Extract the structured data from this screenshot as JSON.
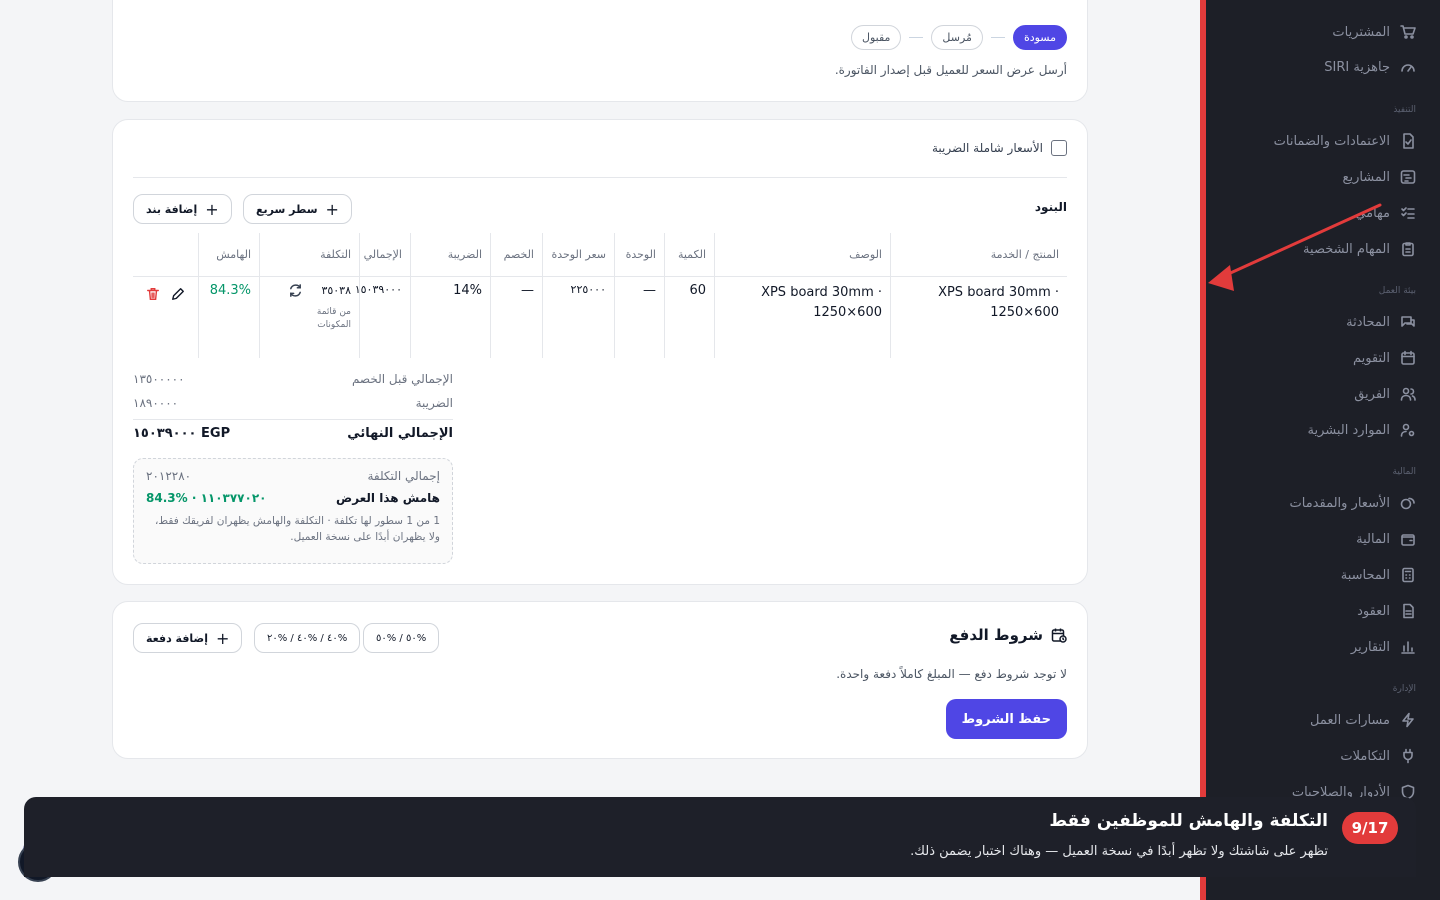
{
  "sidebar": {
    "top_items": [
      {
        "label": "المشتريات",
        "icon": "cart-icon"
      },
      {
        "label": "جاهزية SIRI",
        "icon": "gauge-icon"
      }
    ],
    "sections": [
      {
        "title": "التنفيذ",
        "items": [
          {
            "label": "الاعتمادات والضمانات",
            "icon": "file-check-icon"
          },
          {
            "label": "المشاريع",
            "icon": "gantt-icon"
          },
          {
            "label": "مهامي",
            "icon": "task-list-icon"
          },
          {
            "label": "المهام الشخصية",
            "icon": "clipboard-icon"
          }
        ]
      },
      {
        "title": "بيئة العمل",
        "items": [
          {
            "label": "المحادثة",
            "icon": "chat-icon"
          },
          {
            "label": "التقويم",
            "icon": "calendar-icon"
          },
          {
            "label": "الفريق",
            "icon": "users-icon"
          },
          {
            "label": "الموارد البشرية",
            "icon": "user-gear-icon"
          }
        ]
      },
      {
        "title": "المالية",
        "items": [
          {
            "label": "الأسعار والمقدمات",
            "icon": "coins-icon"
          },
          {
            "label": "المالية",
            "icon": "wallet-icon"
          },
          {
            "label": "المحاسبة",
            "icon": "calculator-icon"
          },
          {
            "label": "العقود",
            "icon": "document-icon"
          },
          {
            "label": "التقارير",
            "icon": "bar-chart-icon"
          }
        ]
      },
      {
        "title": "الإدارة",
        "items": [
          {
            "label": "مسارات العمل",
            "icon": "lightning-icon"
          },
          {
            "label": "التكاملات",
            "icon": "plug-icon"
          },
          {
            "label": "الأدوار والصلاحيات",
            "icon": "shield-icon"
          }
        ]
      }
    ]
  },
  "status": {
    "steps": [
      "مسودة",
      "مُرسل",
      "مقبول"
    ],
    "active": "مسودة",
    "hint": "أرسل عرض السعر للعميل قبل إصدار الفاتورة."
  },
  "items_card": {
    "tax_inclusive_label": "الأسعار شاملة الضريبة",
    "section_title": "البنود",
    "quick_row_label": "سطر سريع",
    "add_item_label": "إضافة بند",
    "columns": {
      "product": "المنتج / الخدمة",
      "description": "الوصف",
      "quantity": "الكمية",
      "unit": "الوحدة",
      "unit_price": "سعر الوحدة",
      "discount": "الخصم",
      "tax": "الضريبة",
      "total": "الإجمالي",
      "cost": "التكلفة",
      "margin": "الهامش"
    },
    "row": {
      "product": "XPS board 30mm · 1250×600",
      "description": "XPS board 30mm · 1250×600",
      "quantity": "60",
      "unit": "—",
      "unit_price": "٢٢٥٠٠٠",
      "discount": "—",
      "tax": "14%",
      "total": "١٥٠٣٩٠٠٠",
      "cost": "٣٥٠٣٨",
      "cost_source": "من قائمة المكونات",
      "margin": "84.3%"
    },
    "summary": {
      "subtotal_label": "الإجمالي قبل الخصم",
      "subtotal_value": "١٣٥٠٠٠٠٠",
      "tax_label": "الضريبة",
      "tax_value": "١٨٩٠٠٠٠",
      "grand_total_label": "الإجمالي النهائي",
      "grand_total_value": "EGP ١٥٠٣٩٠٠٠"
    },
    "cost_box": {
      "total_cost_label": "إجمالي التكلفة",
      "total_cost_value": "٢٠١٢٢٨٠",
      "margin_label": "هامش هذا العرض",
      "margin_amount": "١١٠٣٧٧٠٢٠",
      "margin_percent": "84.3%",
      "note": "1 من 1 سطور لها تكلفة · التكلفة والهامش يظهران لفريقك فقط، ولا يظهران أبدًا على نسخة العميل."
    }
  },
  "payment_card": {
    "title": "شروط الدفع",
    "presets": [
      "%٥٠ / %٥٠",
      "%٤٠ / %٤٠ / %٢٠"
    ],
    "add_payment_label": "إضافة دفعة",
    "empty_text": "لا توجد شروط دفع — المبلغ كاملاً دفعة واحدة.",
    "save_label": "حفظ الشروط"
  },
  "tour": {
    "step": "9/17",
    "title": "التكلفة والهامش للموظفين فقط",
    "body": "تظهر على شاشتك ولا تظهر أبدًا في نسخة العميل — وهناك اختبار يضمن ذلك."
  },
  "colors": {
    "accent": "#4f46e5",
    "tour_badge": "#e23b3b",
    "margin_green": "#059669",
    "sidebar_bg": "#1d1f27"
  }
}
